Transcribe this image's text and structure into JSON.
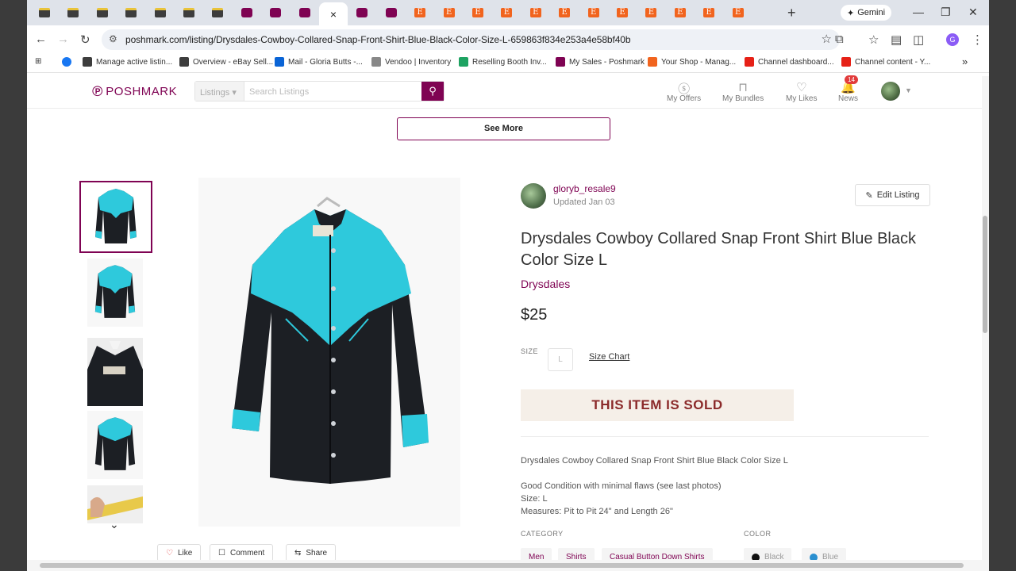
{
  "browser": {
    "tab_close": "×",
    "new_tab": "+",
    "gemini": "Gemini",
    "url": "poshmark.com/listing/Drysdales-Cowboy-Collared-Snap-Front-Shirt-Blue-Black-Color-Size-L-659863f834e253a4e58bf40b",
    "profile_initial": "G",
    "tabs": [
      "ebay",
      "ebay",
      "ebay",
      "ebay",
      "ebay",
      "ebay",
      "ebay",
      "posh",
      "posh",
      "posh",
      "active",
      "posh",
      "posh",
      "etsy",
      "etsy",
      "etsy",
      "etsy",
      "etsy",
      "etsy",
      "etsy",
      "etsy",
      "etsy",
      "etsy",
      "etsy",
      "etsy"
    ]
  },
  "bookmarks": [
    {
      "label": "",
      "icon": "facebook"
    },
    {
      "label": "Manage active listin...",
      "icon": "ebay"
    },
    {
      "label": "Overview - eBay Sell...",
      "icon": "ebay"
    },
    {
      "label": "Mail - Gloria Butts -...",
      "icon": "mail"
    },
    {
      "label": "Vendoo | Inventory",
      "icon": "vendoo"
    },
    {
      "label": "Reselling Booth Inv...",
      "icon": "sheets"
    },
    {
      "label": "My Sales - Poshmark",
      "icon": "posh"
    },
    {
      "label": "Your Shop - Manag...",
      "icon": "etsy"
    },
    {
      "label": "Channel dashboard...",
      "icon": "youtube"
    },
    {
      "label": "Channel content - Y...",
      "icon": "youtube"
    }
  ],
  "site": {
    "logo": "POSHMARK",
    "search_category": "Listings",
    "search_placeholder": "Search Listings",
    "nav": {
      "offers": "My Offers",
      "bundles": "My Bundles",
      "likes": "My Likes",
      "news": "News",
      "news_badge": "14"
    },
    "see_more": "See More"
  },
  "listing": {
    "seller": "gloryb_resale9",
    "updated": "Updated Jan 03",
    "edit": "Edit Listing",
    "title": "Drysdales Cowboy Collared Snap Front Shirt Blue Black Color Size L",
    "brand": "Drysdales",
    "price": "$25",
    "size_label": "SIZE",
    "size_value": "L",
    "size_chart": "Size Chart",
    "sold": "THIS ITEM IS SOLD",
    "desc_line1": "Drysdales Cowboy Collared Snap Front Shirt Blue Black Color Size L",
    "desc_line2": "Good Condition with minimal flaws (see last photos)",
    "desc_line3": "Size: L",
    "desc_line4": "Measures: Pit to Pit 24\" and Length 26\"",
    "category_label": "CATEGORY",
    "categories": [
      "Men",
      "Shirts",
      "Casual Button Down Shirts"
    ],
    "color_label": "COLOR",
    "colors": [
      {
        "name": "Black",
        "hex": "#111111"
      },
      {
        "name": "Blue",
        "hex": "#2a8fd0"
      }
    ],
    "actions": {
      "like": "Like",
      "comment": "Comment",
      "share": "Share"
    }
  },
  "colors": {
    "brand": "#7f0353",
    "accent": "#2ec9dc",
    "sold_bg": "#f5efe8",
    "sold_text": "#8b2a2a"
  }
}
